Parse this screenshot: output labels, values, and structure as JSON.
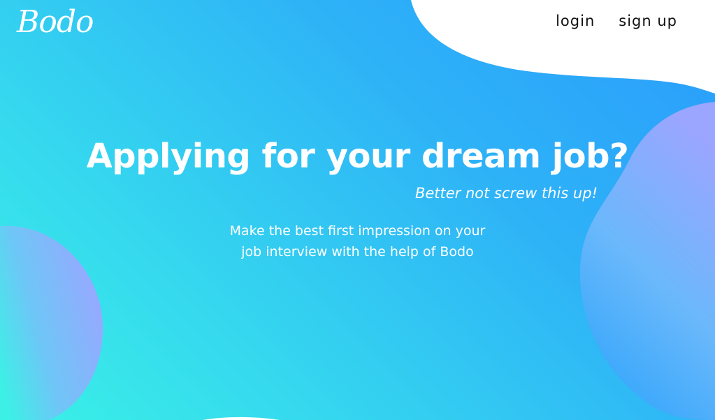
{
  "brand": {
    "logo_text": "Bodo"
  },
  "nav": {
    "login_label": "login",
    "signup_label": "sign up"
  },
  "hero": {
    "headline": "Applying for your dream job?",
    "tagline": "Better not screw this up!",
    "description_line1": "Make the best first impression on your",
    "description_line2": "job interview with the help of Bodo"
  },
  "colors": {
    "gradient_start": "#3af2e6",
    "gradient_end": "#2a9cfc",
    "blob_purple": "#9aa6ff",
    "text_primary": "#ffffff",
    "nav_text": "#111111"
  }
}
